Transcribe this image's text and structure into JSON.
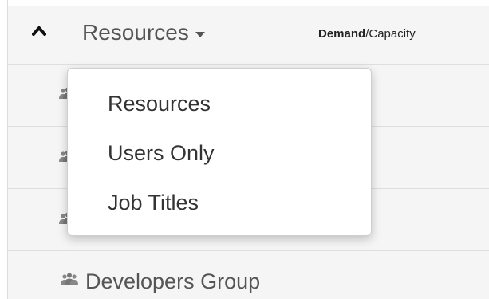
{
  "header": {
    "resources_label": "Resources",
    "demand_label": "Demand",
    "capacity_label": "/Capacity"
  },
  "dropdown": {
    "items": [
      {
        "label": "Resources"
      },
      {
        "label": "Users Only"
      },
      {
        "label": "Job Titles"
      }
    ]
  },
  "list": {
    "visible_group_label": "Developers Group"
  },
  "icons": {
    "collapse": "chevron-up-icon",
    "dropdown_caret": "caret-down-icon",
    "group": "users-group-icon"
  },
  "colors": {
    "row_background": "#f5f5f5",
    "text": "#555555",
    "menu_background": "#ffffff"
  }
}
